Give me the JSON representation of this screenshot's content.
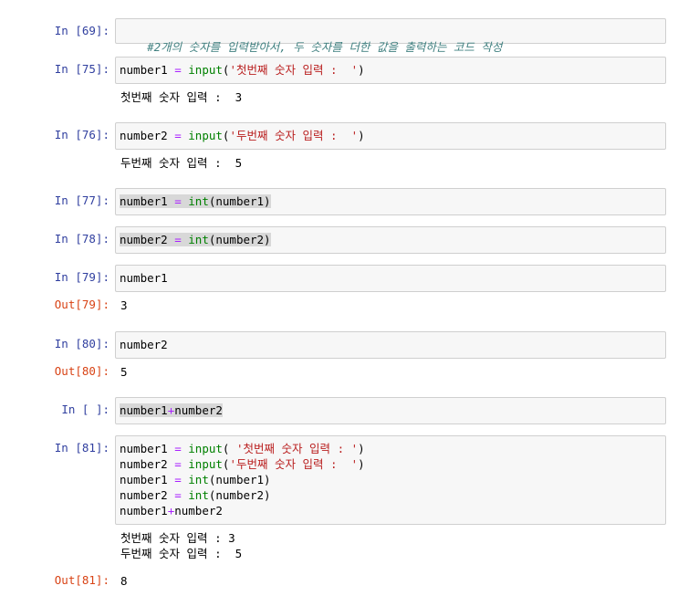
{
  "cells": [
    {
      "prompt": "In [69]:",
      "code": [
        [
          [
            "comment",
            "#2개의 숫자를 입력받아서, 두 숫자를 더한 값을 출력하는 코드 작성"
          ]
        ]
      ]
    },
    {
      "prompt": "In [75]:",
      "code": [
        [
          [
            "name",
            "number1"
          ],
          [
            "op",
            " = "
          ],
          [
            "builtin",
            "input"
          ],
          [
            "punc",
            "("
          ],
          [
            "str",
            "'첫번째 숫자 입력 :  '"
          ],
          [
            "punc",
            ")"
          ]
        ]
      ],
      "stdout": "첫번째 숫자 입력 :  3"
    },
    {
      "prompt": "In [76]:",
      "code": [
        [
          [
            "name",
            "number2"
          ],
          [
            "op",
            " = "
          ],
          [
            "builtin",
            "input"
          ],
          [
            "punc",
            "("
          ],
          [
            "str",
            "'두번째 숫자 입력 :  '"
          ],
          [
            "punc",
            ")"
          ]
        ]
      ],
      "stdout": "두번째 숫자 입력 :  5"
    },
    {
      "prompt": "In [77]:",
      "code": [
        [
          [
            "name",
            "number1"
          ],
          [
            "op",
            " = "
          ],
          [
            "builtin",
            "int"
          ],
          [
            "punc",
            "(number1)"
          ]
        ]
      ]
    },
    {
      "prompt": "In [78]:",
      "code": [
        [
          [
            "name",
            "number2"
          ],
          [
            "op",
            " = "
          ],
          [
            "builtin",
            "int"
          ],
          [
            "punc",
            "(number2)"
          ]
        ]
      ]
    },
    {
      "prompt": "In [79]:",
      "code": [
        [
          [
            "name",
            "number1"
          ]
        ]
      ],
      "out_prompt": "Out[79]:",
      "out": "3"
    },
    {
      "prompt": "In [80]:",
      "code": [
        [
          [
            "name",
            "number2"
          ]
        ]
      ],
      "out_prompt": "Out[80]:",
      "out": "5"
    },
    {
      "prompt": "In [ ]:",
      "code": [
        [
          [
            "name",
            "number1"
          ],
          [
            "op",
            "+"
          ],
          [
            "name",
            "number2"
          ]
        ]
      ]
    },
    {
      "prompt": "In [81]:",
      "code": [
        [
          [
            "name",
            "number1"
          ],
          [
            "op",
            " = "
          ],
          [
            "builtin",
            "input"
          ],
          [
            "punc",
            "( "
          ],
          [
            "str",
            "'첫번째 숫자 입력 : '"
          ],
          [
            "punc",
            ")"
          ]
        ],
        [
          [
            "name",
            "number2"
          ],
          [
            "op",
            " = "
          ],
          [
            "builtin",
            "input"
          ],
          [
            "punc",
            "("
          ],
          [
            "str",
            "'두번째 숫자 입력 :  '"
          ],
          [
            "punc",
            ")"
          ]
        ],
        [
          [
            "name",
            "number1"
          ],
          [
            "op",
            " = "
          ],
          [
            "builtin",
            "int"
          ],
          [
            "punc",
            "(number1)"
          ]
        ],
        [
          [
            "name",
            "number2"
          ],
          [
            "op",
            " = "
          ],
          [
            "builtin",
            "int"
          ],
          [
            "punc",
            "(number2)"
          ]
        ],
        [
          [
            "name",
            "number1"
          ],
          [
            "op",
            "+"
          ],
          [
            "name",
            "number2"
          ]
        ]
      ],
      "stdout": "첫번째 숫자 입력 : 3\n두번째 숫자 입력 :  5",
      "out_prompt": "Out[81]:",
      "out": "8"
    }
  ]
}
